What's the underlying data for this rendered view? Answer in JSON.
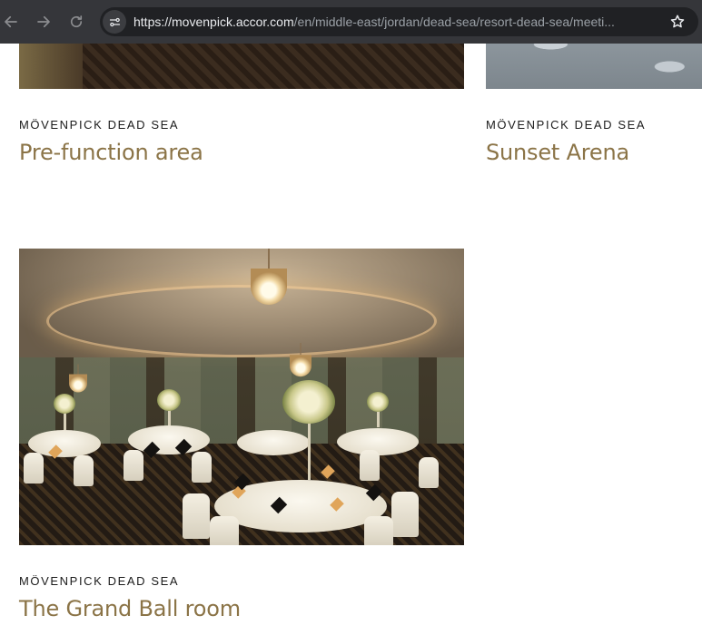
{
  "browser": {
    "url_host": "https://movenpick.accor.com",
    "url_path": "/en/middle-east/jordan/dead-sea/resort-dead-sea/meeti...",
    "icons": [
      "back-icon",
      "forward-icon",
      "reload-icon",
      "site-settings-icon",
      "bookmark-star-icon"
    ]
  },
  "cards": [
    {
      "brand": "MÖVENPICK DEAD SEA",
      "title": "Pre-function area"
    },
    {
      "brand": "MÖVENPICK DEAD SEA",
      "title": "Sunset Arena"
    },
    {
      "brand": "MÖVENPICK DEAD SEA",
      "title": "The Grand Ball room"
    }
  ],
  "colors": {
    "title": "#8b7447",
    "brand": "#1b1b1b",
    "toolbar": "#35363a",
    "omnibox": "#202124"
  }
}
